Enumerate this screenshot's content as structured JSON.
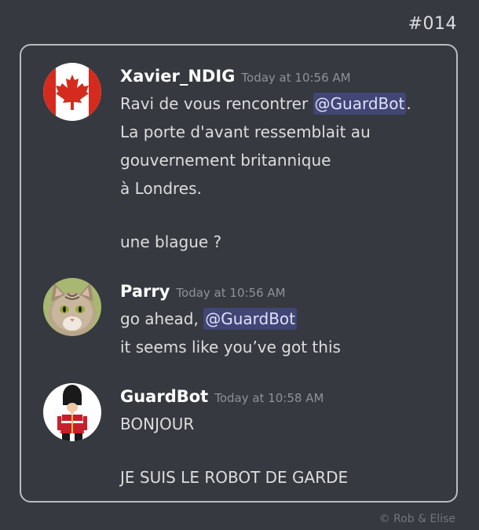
{
  "comic_number": "#014",
  "credit": "©  Rob & Elise",
  "messages": [
    {
      "username": "Xavier_NDIG",
      "timestamp": "Today at 10:56 AM",
      "avatar_icon": "canada-flag-icon",
      "line1_before": "Ravi de vous rencontrer ",
      "line1_mention": "@GuardBot",
      "line1_after": ".",
      "line2": "La porte d'avant ressemblait au",
      "line3": "gouvernement britannique",
      "line4": "à Londres.",
      "line5": "une blague ?"
    },
    {
      "username": "Parry",
      "timestamp": "Today at 10:56 AM",
      "avatar_icon": "cat-face-icon",
      "line1_before": "go ahead, ",
      "line1_mention": "@GuardBot",
      "line2": "it seems like you’ve got this"
    },
    {
      "username": "GuardBot",
      "timestamp": "Today at 10:58 AM",
      "avatar_icon": "royal-guard-icon",
      "line1": "BONJOUR",
      "line2": "JE SUIS LE ROBOT DE GARDE"
    }
  ],
  "colors": {
    "background": "#36393f",
    "mention_bg": "#414675",
    "mention_text": "#dee0fc",
    "timestamp": "#8e9297",
    "flag_red": "#d52b1e"
  }
}
